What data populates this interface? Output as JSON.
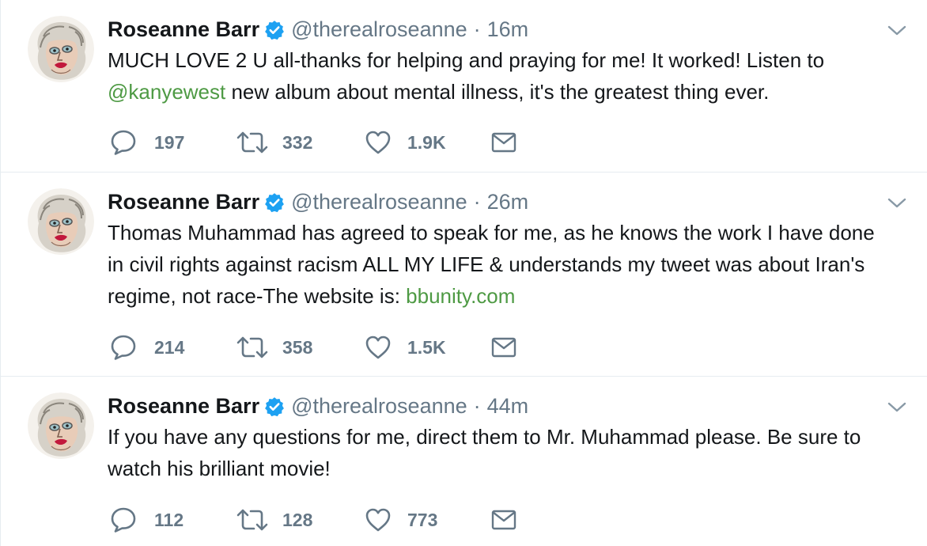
{
  "colors": {
    "text": "#14171a",
    "muted": "#657786",
    "link": "#4e9a44",
    "verified": "#1da1f2",
    "divider": "#e6ecf0"
  },
  "tweets": [
    {
      "name": "Roseanne Barr",
      "handle": "@therealroseanne",
      "separator": "·",
      "time": "16m",
      "text_parts": [
        "MUCH LOVE 2 U all-thanks for helping and praying for me! It worked! Listen to ",
        "@kanyewest",
        " new album about mental illness, it's the greatest thing ever."
      ],
      "replies": "197",
      "retweets": "332",
      "likes": "1.9K",
      "icons": [
        "reply-icon",
        "retweet-icon",
        "heart-icon",
        "mail-icon",
        "chevron-down-icon"
      ]
    },
    {
      "name": "Roseanne Barr",
      "handle": "@therealroseanne",
      "separator": "·",
      "time": "26m",
      "text_parts": [
        "Thomas Muhammad has agreed to speak for me, as he knows the work I have done in civil rights against racism ALL MY LIFE & understands my tweet was about Iran's regime, not race-The website is: ",
        "bbunity.com"
      ],
      "replies": "214",
      "retweets": "358",
      "likes": "1.5K",
      "icons": [
        "reply-icon",
        "retweet-icon",
        "heart-icon",
        "mail-icon",
        "chevron-down-icon"
      ]
    },
    {
      "name": "Roseanne Barr",
      "handle": "@therealroseanne",
      "separator": "·",
      "time": "44m",
      "text_parts": [
        "If you have any questions for me, direct them to Mr. Muhammad please. Be sure to watch his brilliant movie!"
      ],
      "replies": "112",
      "retweets": "128",
      "likes": "773",
      "icons": [
        "reply-icon",
        "retweet-icon",
        "heart-icon",
        "mail-icon",
        "chevron-down-icon"
      ]
    }
  ]
}
